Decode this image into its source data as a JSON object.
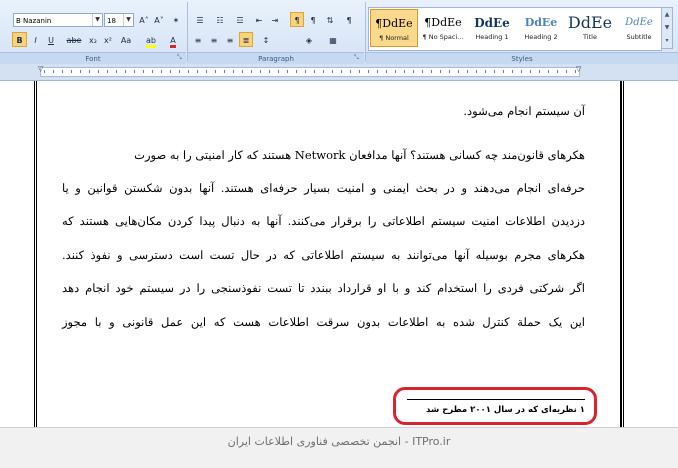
{
  "ribbon": {
    "font": {
      "group_label": "Font",
      "font_name": "B Nazanin",
      "font_size": "18",
      "grow_label": "A˄",
      "shrink_label": "A˅",
      "clear_label": "✶",
      "bold": "B",
      "italic": "I",
      "underline": "U",
      "strike": "abe",
      "subscript": "x₂",
      "superscript": "x²",
      "change_case": "Aa",
      "highlight": "ab",
      "font_color": "A"
    },
    "paragraph": {
      "group_label": "Paragraph",
      "pilcrow": "¶"
    },
    "styles": {
      "group_label": "Styles",
      "items": [
        {
          "preview": "¶DdEe",
          "name": "¶ Normal"
        },
        {
          "preview": "¶DdEe",
          "name": "¶ No Spaci..."
        },
        {
          "preview": "DdEe",
          "name": "Heading 1"
        },
        {
          "preview": "DdEe",
          "name": "Heading 2"
        },
        {
          "preview": "DdEe",
          "name": "Title"
        },
        {
          "preview": "DdEe",
          "name": "Subtitle"
        }
      ]
    }
  },
  "colors": {
    "highlight_color": "#ffff00",
    "font_color": "#d9232e",
    "accent": "#f9d27c",
    "oval": "#d9232e"
  },
  "document": {
    "lines": [
      "آن سیستم انجام می‌شود.",
      "هکرهای قانون‌مند چه کسانی هستند؟ آنها مدافعان Network هستند که کار امنیتی را به صورت",
      "حرفه‌ای انجام می‌دهند و در بحث ایمنی و امنیت بسیار حرفه‌ای هستند. آنها بدون شکستن قوانین و یا",
      "دزدیدن اطلاعات امنیت سیستم اطلاعاتی را برقرار می‌کنند. آنها به دنبال پیدا کردن مکان‌هایی هستند که",
      "هکرهای مجرم بوسیله آنها می‌توانند به سیستم اطلاعاتی که در حال تست است دسترسی و نفوذ کنند.",
      "اگر شرکتی فردی را استخدام کند و با او قرارداد ببندد تا تست نفوذسنجی را در سیستم خود انجام دهد",
      "این یک حملة کنترل شده به اطلاعات بدون سرقت اطلاعات هست که این عمل قانونی و با مجوز"
    ],
    "footnote": "۱ نظریه‌ای که در سال ۲۰۰۱ مطرح شد"
  },
  "watermark": "ITPro.ir - انجمن تخصصی فناوری اطلاعات ایران"
}
